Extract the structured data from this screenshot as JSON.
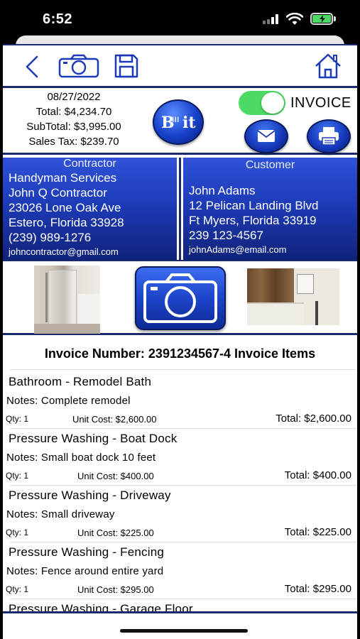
{
  "status_bar": {
    "time": "6:52"
  },
  "toolbar": {
    "back": "back-chevron-icon",
    "camera": "camera-icon",
    "save": "save-icon",
    "home": "home-icon"
  },
  "summary": {
    "date": "08/27/2022",
    "total": "Total: $4,234.70",
    "subtotal": "SubTotal: $3,995.00",
    "sales_tax": "Sales Tax: $239.70",
    "logo_text": "Bill it",
    "invoice_toggle_label": "INVOICE",
    "invoice_toggle_on": true
  },
  "contractor": {
    "title": "Contractor",
    "business": "Handyman Services",
    "name": "John Q Contractor",
    "address1": "23026 Lone Oak Ave",
    "address2": "Estero, Florida 33928",
    "phone": "(239) 989-1276",
    "email": "johncontractor@gmail.com"
  },
  "customer": {
    "title": "Customer",
    "name": "John Adams",
    "address1": "12 Pelican Landing Blvd",
    "address2": "Ft Myers, Florida  33919",
    "phone": "239 123-4567",
    "email": "johnAdams@email.com"
  },
  "invoice": {
    "header": "Invoice Number:  2391234567-4 Invoice Items",
    "items": [
      {
        "title": "Bathroom -  Remodel Bath",
        "notes": "Notes: Complete remodel",
        "qty": "Qty: 1",
        "unit_cost": "Unit Cost: $2,600.00",
        "total": "Total: $2,600.00"
      },
      {
        "title": "Pressure Washing -  Boat Dock",
        "notes": "Notes: Small boat dock 10 feet",
        "qty": "Qty: 1",
        "unit_cost": "Unit Cost: $400.00",
        "total": "Total: $400.00"
      },
      {
        "title": "Pressure Washing -  Driveway",
        "notes": "Notes: Small driveway",
        "qty": "Qty: 1",
        "unit_cost": "Unit Cost: $225.00",
        "total": "Total: $225.00"
      },
      {
        "title": "Pressure Washing - Fencing",
        "notes": "Notes: Fence around entire yard",
        "qty": "Qty: 1",
        "unit_cost": "Unit Cost: $295.00",
        "total": "Total: $295.00"
      },
      {
        "title": "Pressure Washing -  Garage Floor",
        "notes": "",
        "qty": "",
        "unit_cost": "",
        "total": ""
      }
    ]
  },
  "colors": {
    "accent_blue": "#1d3bb8",
    "border_navy": "#1a2a6c",
    "toggle_green": "#4cd964"
  }
}
